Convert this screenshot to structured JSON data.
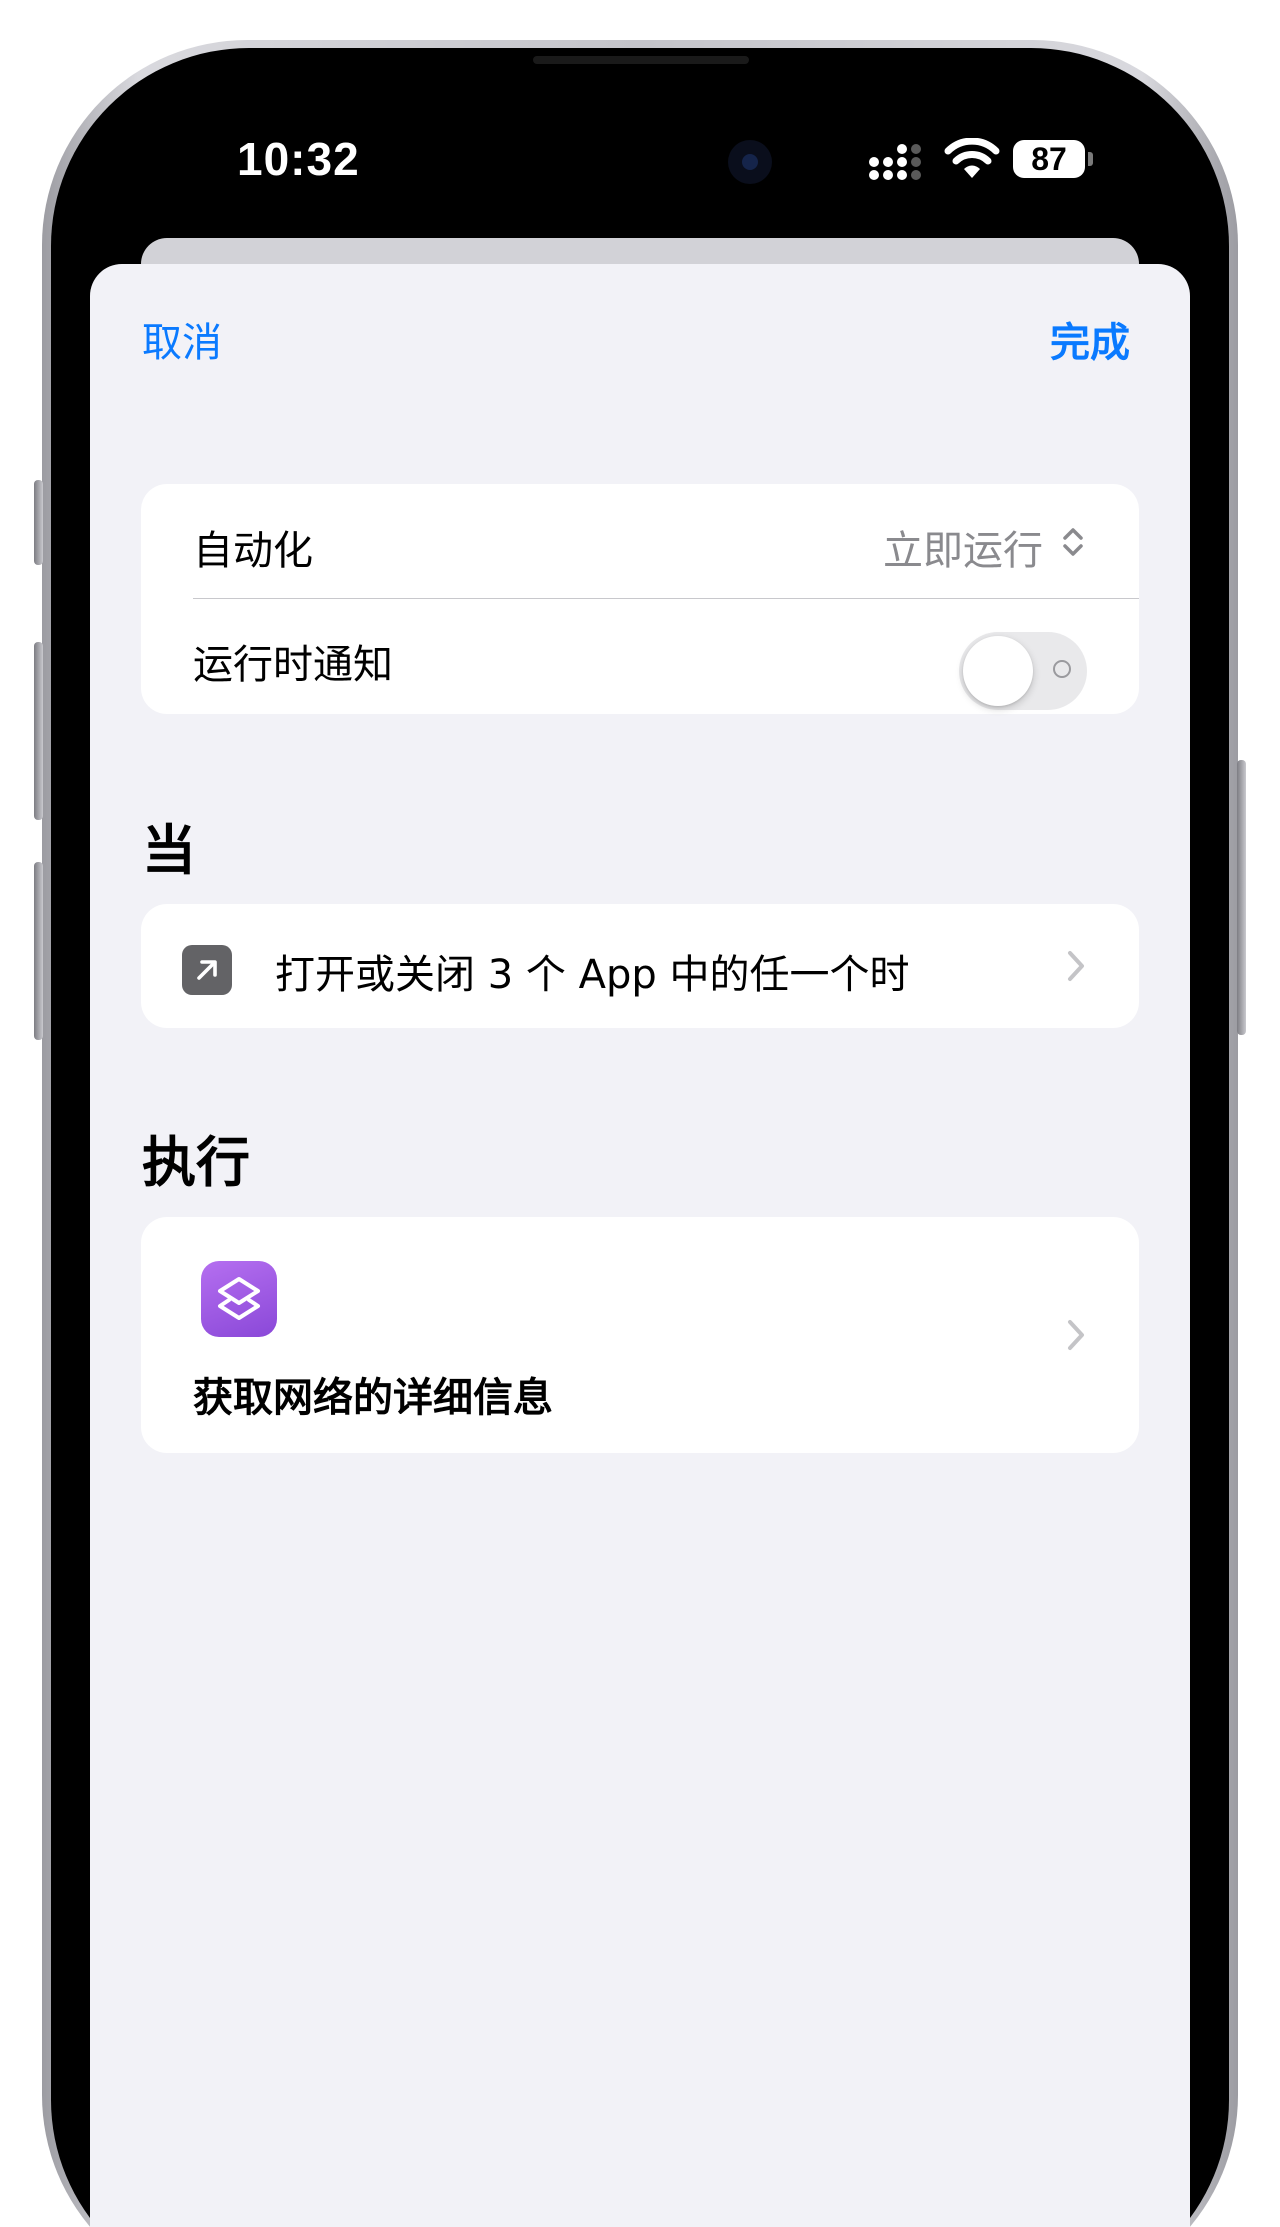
{
  "status_bar": {
    "time": "10:32",
    "battery": "87"
  },
  "nav": {
    "cancel_label": "取消",
    "done_label": "完成"
  },
  "settings": {
    "automation_label": "自动化",
    "automation_value": "立即运行",
    "notify_label": "运行时通知",
    "notify_enabled": false
  },
  "when": {
    "title": "当",
    "trigger_label": "打开或关闭 3 个 App 中的任一个时"
  },
  "run": {
    "title": "执行",
    "action_label": "获取网络的详细信息"
  },
  "colors": {
    "accent": "#0a7aff",
    "sheet_background": "#f2f2f7",
    "card_background": "#ffffff",
    "secondary_text": "#8a8a8e",
    "action_icon": "#9a55e2",
    "trigger_icon": "#636366"
  },
  "icons": {
    "trigger": "arrow-up-right-icon",
    "action": "shortcuts-icon",
    "automation_value": "chevron-up-down-icon",
    "row": "chevron-right-icon"
  }
}
